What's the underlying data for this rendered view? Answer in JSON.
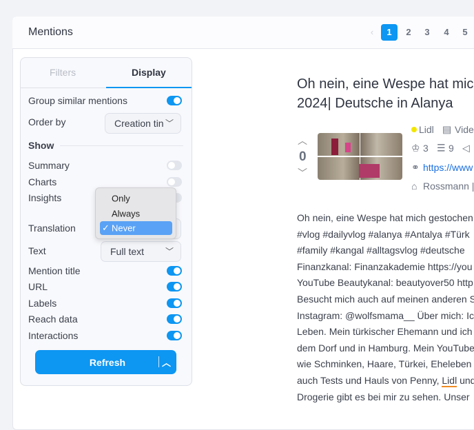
{
  "header": {
    "title": "Mentions",
    "pagination": {
      "prev": "‹",
      "pages": [
        "1",
        "2",
        "3",
        "4",
        "5"
      ],
      "current": "1"
    }
  },
  "sidebar": {
    "tabs": [
      {
        "label": "Filters",
        "active": false
      },
      {
        "label": "Display",
        "active": true
      }
    ],
    "group_similar": {
      "label": "Group similar mentions",
      "on": true
    },
    "order_by": {
      "label": "Order by",
      "value": "Creation tin"
    },
    "show_heading": "Show",
    "summary": {
      "label": "Summary",
      "on": false
    },
    "charts": {
      "label": "Charts",
      "on": false
    },
    "insights": {
      "label": "Insights",
      "on": false
    },
    "translation": {
      "label": "Translation",
      "value": "Never",
      "options": [
        "Only",
        "Always",
        "Never"
      ],
      "check": "✓"
    },
    "text": {
      "label": "Text",
      "value": "Full text"
    },
    "mention_title": {
      "label": "Mention title",
      "on": true
    },
    "url": {
      "label": "URL",
      "on": true
    },
    "labels": {
      "label": "Labels",
      "on": true
    },
    "reach": {
      "label": "Reach data",
      "on": true
    },
    "interactions": {
      "label": "Interactions",
      "on": true
    },
    "refresh": "Refresh"
  },
  "mention": {
    "title_lines": [
      "Oh nein, eine Wespe hat mich",
      "2024| Deutsche in Alanya"
    ],
    "votes": "0",
    "brand": "Lidl",
    "brand_color": "#f2e600",
    "type": "Vide",
    "stat1": "3",
    "stat2": "9",
    "link": "https://www",
    "tag": "Rossmann |",
    "body_lines": [
      "Oh nein, eine Wespe hat mich gestochen",
      "#vlog #dailyvlog #alanya #Antalya #Türk",
      "#family #kangal #alltagsvlog #deutsche",
      "Finanzkanal: Finanzakademie https://you",
      "YouTube Beautykanal: beautyover50 http",
      "Besucht mich auch auf meinen anderen S",
      "Instagram: @wolfsmama__ Über mich: Ic",
      "Leben. Mein türkischer Ehemann und ich",
      "dem Dorf und in Hamburg. Mein YouTube",
      "wie Schminken, Haare, Türkei, Eheleben",
      "auch Tests und Hauls von Penny, ",
      "Drogerie gibt es bei mir zu sehen. Unser"
    ],
    "highlight": "Lidl",
    "highlight_after": " und"
  },
  "colors": {
    "accent": "#0d96f2",
    "highlight_underline": "#f08a24"
  }
}
